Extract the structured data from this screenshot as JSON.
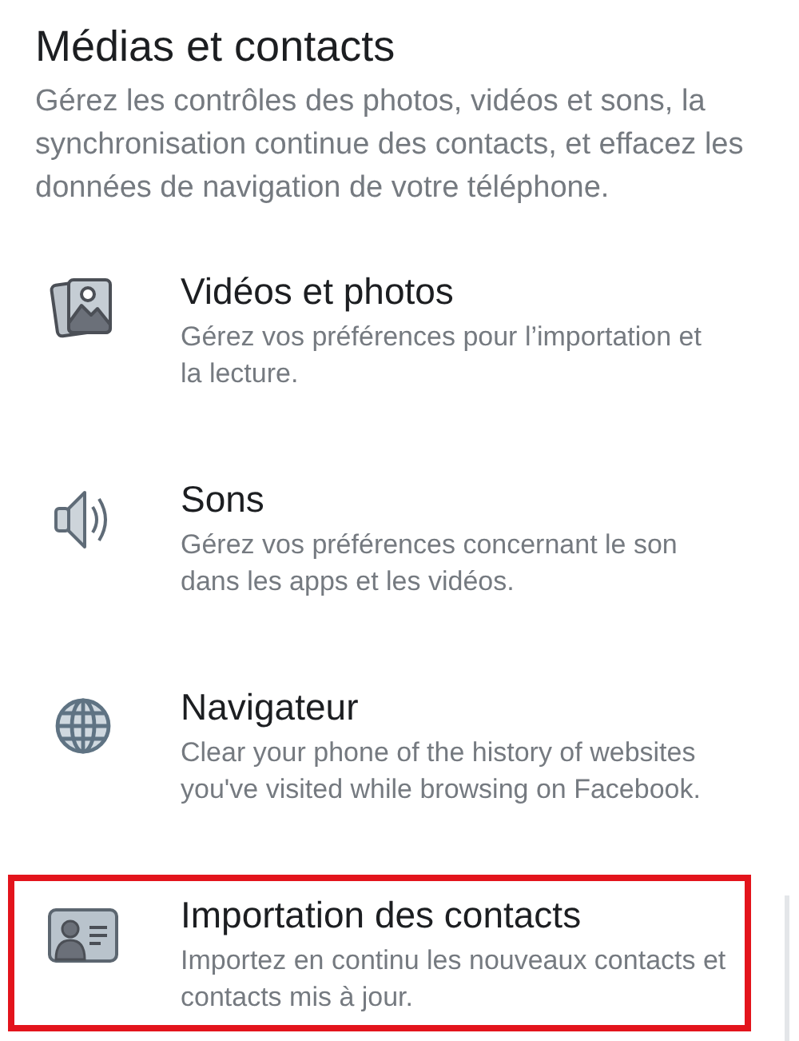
{
  "section": {
    "title": "Médias et contacts",
    "description": "Gérez les contrôles des photos, vidéos et sons, la synchronisation continue des contacts, et effacez les données de navigation de votre téléphone."
  },
  "items": [
    {
      "kind": "photos",
      "title": "Vidéos et photos",
      "description": "Gérez vos préférences pour l’importation et la lecture.",
      "highlighted": false
    },
    {
      "kind": "sound",
      "title": "Sons",
      "description": "Gérez vos préférences concernant le son dans les apps et les vidéos.",
      "highlighted": false
    },
    {
      "kind": "globe",
      "title": "Navigateur",
      "description": "Clear your phone of the history of websites you've visited while browsing on Facebook.",
      "highlighted": false
    },
    {
      "kind": "contact",
      "title": "Importation des contacts",
      "description": "Importez en continu les nouveaux contacts et contacts mis à jour.",
      "highlighted": true
    }
  ]
}
